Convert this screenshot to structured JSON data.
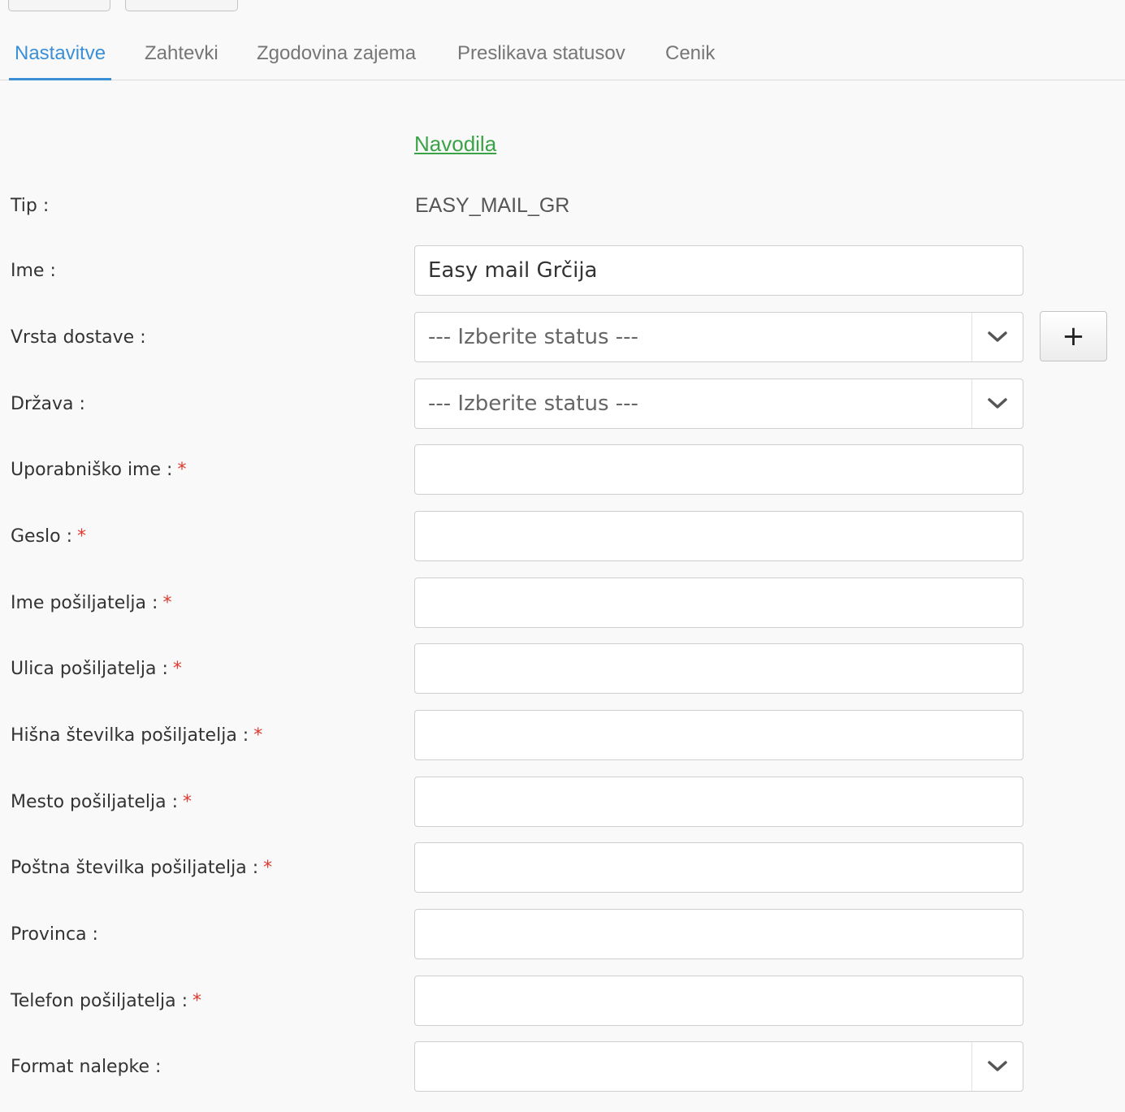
{
  "tabs": [
    {
      "label": "Nastavitve",
      "active": true
    },
    {
      "label": "Zahtevki"
    },
    {
      "label": "Zgodovina zajema"
    },
    {
      "label": "Preslikava statusov"
    },
    {
      "label": "Cenik"
    }
  ],
  "help_link": "Navodila",
  "form": {
    "tip": {
      "label": "Tip :",
      "value": "EASY_MAIL_GR"
    },
    "ime": {
      "label": "Ime :",
      "value": "Easy mail Grčija"
    },
    "vrsta_dostave": {
      "label": "Vrsta dostave :",
      "selected": "--- Izberite status ---",
      "add_label": "+"
    },
    "drzava": {
      "label": "Država :",
      "selected": "--- Izberite status ---"
    },
    "uporabnisko_ime": {
      "label": "Uporabniško ime :",
      "required_mark": "*",
      "value": ""
    },
    "geslo": {
      "label": "Geslo :",
      "required_mark": "*",
      "value": ""
    },
    "ime_posiljatelja": {
      "label": "Ime pošiljatelja :",
      "required_mark": "*",
      "value": ""
    },
    "ulica_posiljatelja": {
      "label": "Ulica pošiljatelja :",
      "required_mark": "*",
      "value": ""
    },
    "hisna_stevilka": {
      "label": "Hišna številka pošiljatelja :",
      "required_mark": "*",
      "value": ""
    },
    "mesto_posiljatelja": {
      "label": "Mesto pošiljatelja :",
      "required_mark": "*",
      "value": ""
    },
    "postna_stevilka": {
      "label": "Poštna številka pošiljatelja :",
      "required_mark": "*",
      "value": ""
    },
    "provinca": {
      "label": "Provinca :",
      "value": ""
    },
    "telefon_posiljatelja": {
      "label": "Telefon pošiljatelja :",
      "required_mark": "*",
      "value": ""
    },
    "format_nalepke": {
      "label": "Format nalepke :",
      "selected": ""
    }
  },
  "colors": {
    "accent": "#3a8fd6",
    "link": "#3aa347",
    "required": "#e0392e"
  }
}
